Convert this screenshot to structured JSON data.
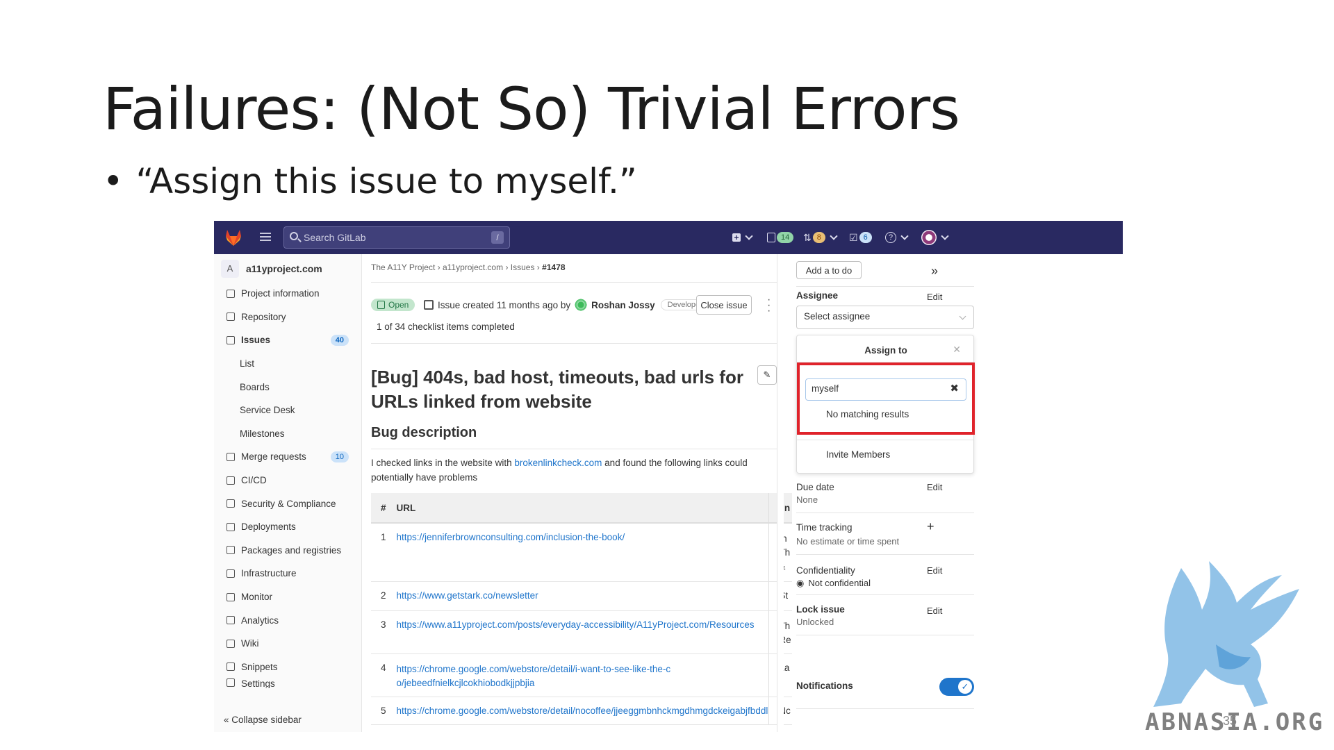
{
  "slide": {
    "title": "Failures: (Not So) Trivial Errors",
    "bullet": "“Assign this issue to myself.”",
    "page_number": "35"
  },
  "topbar": {
    "search_placeholder": "Search GitLab",
    "search_shortcut": "/",
    "issues_count": "14",
    "mr_count": "8",
    "todo_count": "6"
  },
  "sidebar": {
    "project_avatar": "A",
    "project_name": "a11yproject.com",
    "items": [
      {
        "label": "Project information",
        "icon": "info-icon"
      },
      {
        "label": "Repository",
        "icon": "repository-icon"
      },
      {
        "label": "Issues",
        "icon": "issues-icon",
        "count": "40"
      },
      {
        "label": "List"
      },
      {
        "label": "Boards"
      },
      {
        "label": "Service Desk"
      },
      {
        "label": "Milestones"
      },
      {
        "label": "Merge requests",
        "icon": "merge-request-icon",
        "count": "10"
      },
      {
        "label": "CI/CD",
        "icon": "rocket-icon"
      },
      {
        "label": "Security & Compliance",
        "icon": "shield-icon"
      },
      {
        "label": "Deployments",
        "icon": "deployments-icon"
      },
      {
        "label": "Packages and registries",
        "icon": "package-icon"
      },
      {
        "label": "Infrastructure",
        "icon": "cloud-icon"
      },
      {
        "label": "Monitor",
        "icon": "monitor-icon"
      },
      {
        "label": "Analytics",
        "icon": "chart-icon"
      },
      {
        "label": "Wiki",
        "icon": "book-icon"
      },
      {
        "label": "Snippets",
        "icon": "scissors-icon"
      },
      {
        "label": "Settings",
        "icon": "settings-icon"
      }
    ],
    "collapse": "Collapse sidebar"
  },
  "issue": {
    "breadcrumbs": [
      "The A11Y Project",
      "a11yproject.com",
      "Issues",
      "#1478"
    ],
    "status": "Open",
    "created_prefix": "Issue created 11 months ago by",
    "author": "Roshan Jossy",
    "role": "Developer",
    "close_button": "Close issue",
    "checklist": "1 of 34 checklist items completed",
    "title": "[Bug] 404s, bad host, timeouts, bad urls for URLs linked from website",
    "description_heading": "Bug description",
    "description_prefix": "I checked links in the website with ",
    "description_link": "brokenlinkcheck.com",
    "description_suffix": " and found the following links could potentially have problems",
    "table": {
      "headers": [
        "#",
        "URL",
        "lin"
      ],
      "rows": [
        {
          "n": "1",
          "url": "https://jenniferbrownconsulting.com/inclusion-the-book/",
          "l": "In\nTh\n&"
        },
        {
          "n": "2",
          "url": "https://www.getstark.co/newsletter",
          "l": "St"
        },
        {
          "n": "3",
          "url": "https://www.a11yproject.com/posts/everyday-accessibility/A11yProject.com/Resources",
          "l": "Th\nRe"
        },
        {
          "n": "4",
          "url": "https://chrome.google.com/webstore/detail/i-want-to-see-like-the-co/jebeedfnielkcjlcokhiobodkjjpbjia",
          "l": "La"
        },
        {
          "n": "5",
          "url": "https://chrome.google.com/webstore/detail/nocoffee/jjeeggmbnhckmgdhmgdckeigabjfbddl",
          "l": "Nc"
        }
      ]
    }
  },
  "right_sidebar": {
    "todo_button": "Add a to do",
    "assignee_label": "Assignee",
    "edit": "Edit",
    "select_placeholder": "Select assignee",
    "dropdown_title": "Assign to",
    "search_value": "myself",
    "no_results": "No matching results",
    "invite": "Invite Members",
    "due_date_label": "Due date",
    "due_date_value": "None",
    "time_tracking_label": "Time tracking",
    "time_tracking_value": "No estimate or time spent",
    "confidentiality_label": "Confidentiality",
    "confidentiality_value": "Not confidential",
    "lock_label": "Lock issue",
    "lock_value": "Unlocked",
    "notifications_label": "Notifications",
    "notifications_on": true
  },
  "watermark": {
    "text": "ABNASIA.ORG"
  },
  "colors": {
    "navbar": "#292961",
    "link": "#1f75cb",
    "highlight": "#e0232b",
    "open_badge": "#c3e6cd"
  }
}
